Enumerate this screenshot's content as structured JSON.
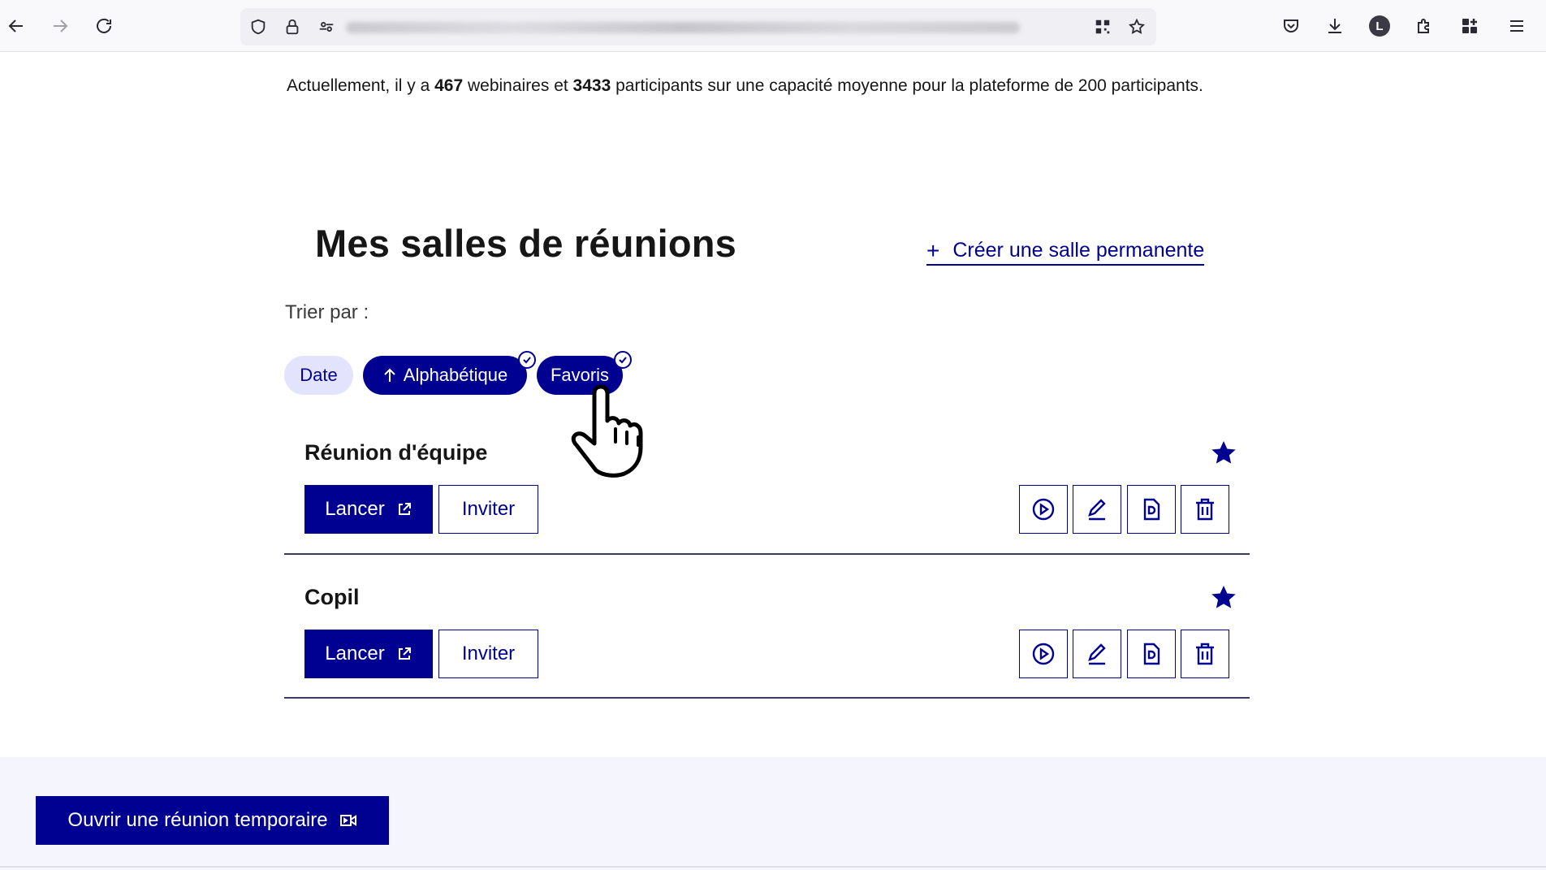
{
  "browser": {
    "icons": [
      "back-icon",
      "forward-icon",
      "reload-icon",
      "shield-icon",
      "lock-icon",
      "permissions-icon",
      "qr-icon",
      "bookmark-star-icon",
      "pocket-icon",
      "download-icon",
      "account-icon",
      "extensions-icon",
      "apps-icon",
      "menu-icon"
    ],
    "account_initial": "L"
  },
  "stats": {
    "prefix": "Actuellement, il y a ",
    "webinars": "467",
    "mid1": " webinaires et ",
    "participants": "3433",
    "suffix": " participants sur une capacité moyenne pour la plateforme de 200 participants."
  },
  "page": {
    "title": "Mes salles de réunions",
    "create_link": "Créer une salle permanente",
    "sort_label": "Trier par :"
  },
  "sort_tags": [
    {
      "label": "Date",
      "selected": false
    },
    {
      "label": "Alphabétique",
      "selected": true
    },
    {
      "label": "Favoris",
      "selected": true
    }
  ],
  "rooms": [
    {
      "name": "Réunion d'équipe",
      "launch": "Lancer",
      "invite": "Inviter",
      "favorite": true
    },
    {
      "name": "Copil",
      "launch": "Lancer",
      "invite": "Inviter",
      "favorite": true
    }
  ],
  "footer": {
    "temp_button": "Ouvrir une réunion temporaire"
  },
  "colors": {
    "primary": "#000091",
    "tag_light": "#e3e3fd",
    "footer_bg": "#f5f5fe"
  }
}
